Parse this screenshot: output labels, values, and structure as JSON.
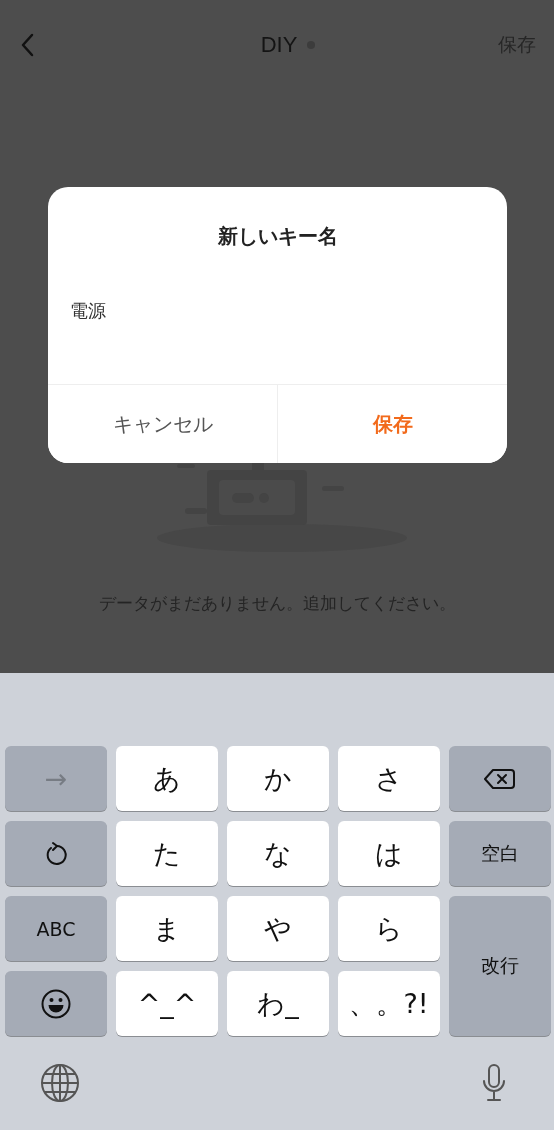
{
  "nav": {
    "title": "DIY",
    "action": {
      "label": "保存",
      "disabled": true
    }
  },
  "empty_state": {
    "message": "データがまだありません。追加してください。"
  },
  "dialog": {
    "title": "新しいキー名",
    "field": {
      "value": "電源"
    },
    "buttons": [
      {
        "label": "キャンセル",
        "primary": false
      },
      {
        "label": "保存",
        "primary": true
      }
    ]
  },
  "keyboard": {
    "keys": [
      {
        "kind": "text",
        "label": "→",
        "disabled": true
      },
      {
        "kind": "char",
        "label": "あ",
        "disabled": false
      },
      {
        "kind": "char",
        "label": "か",
        "disabled": false
      },
      {
        "kind": "char",
        "label": "さ",
        "disabled": false
      },
      {
        "kind": "delete",
        "disabled": false
      },
      {
        "kind": "undo",
        "disabled": false
      },
      {
        "kind": "char",
        "label": "た",
        "disabled": false
      },
      {
        "kind": "char",
        "label": "な",
        "disabled": false
      },
      {
        "kind": "char",
        "label": "は",
        "disabled": false
      },
      {
        "kind": "text",
        "label": "空白",
        "disabled": false
      },
      {
        "kind": "text",
        "label": "ABC",
        "disabled": false
      },
      {
        "kind": "char",
        "label": "ま",
        "disabled": false
      },
      {
        "kind": "char",
        "label": "や",
        "disabled": false
      },
      {
        "kind": "char",
        "label": "ら",
        "disabled": false
      },
      {
        "kind": "return",
        "label": "改行",
        "disabled": false
      },
      {
        "kind": "emoji",
        "disabled": false
      },
      {
        "kind": "char",
        "label": "^_^",
        "disabled": false
      },
      {
        "kind": "char",
        "label": "わ_",
        "disabled": false
      },
      {
        "kind": "char",
        "label": "、。?!",
        "disabled": false
      }
    ]
  }
}
